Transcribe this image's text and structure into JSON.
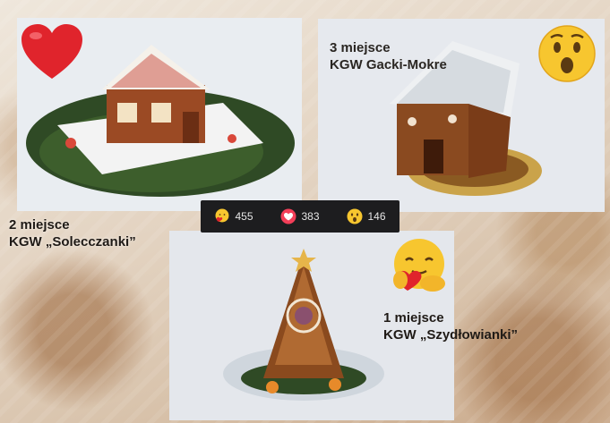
{
  "places": [
    {
      "line1": "3 miejsce",
      "line2": "KGW Gacki-Mokre"
    },
    {
      "line1": "2 miejsce",
      "line2": "KGW „Solecczanki”"
    },
    {
      "line1": "1 miejsce",
      "line2": "KGW „Szydłowianki”"
    }
  ],
  "reactions": [
    {
      "icon": "care-emoji-icon",
      "count": "455"
    },
    {
      "icon": "love-heart-icon",
      "count": "383"
    },
    {
      "icon": "wow-emoji-icon",
      "count": "146"
    }
  ],
  "colors": {
    "heart": "#e0242c",
    "emoji_yellow": "#f7c62f",
    "bar": "#1d1d1f"
  }
}
